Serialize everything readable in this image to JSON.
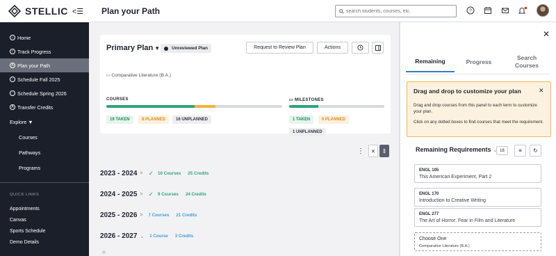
{
  "app": {
    "logo_text": "STELLIC",
    "collapse_label": "<☰",
    "page_title": "Plan your Path"
  },
  "search": {
    "placeholder": "search students, courses, etc."
  },
  "header_icons": [
    "help-icon",
    "calendar-icon",
    "mail-icon",
    "bell-icon"
  ],
  "sidebar": {
    "items": [
      {
        "label": "Home",
        "icon": "home-icon"
      },
      {
        "label": "Track Progress",
        "icon": "check-circle-icon"
      },
      {
        "label": "Plan your Path",
        "icon": "path-icon",
        "active": true
      },
      {
        "label": "Schedule Fall 2025",
        "icon": "schedule-icon"
      },
      {
        "label": "Schedule Spring 2026",
        "icon": "schedule-icon"
      },
      {
        "label": "Transfer Credits",
        "icon": "transfer-icon"
      }
    ],
    "explore_label": "Explore ▼",
    "explore_items": [
      "Courses",
      "Pathways",
      "Programs"
    ],
    "quick_links_title": "QUICK LINKS",
    "quick_links": [
      "Appointments",
      "Canvas",
      "Sports Schedule",
      "Demo Details"
    ]
  },
  "plan": {
    "name": "Primary Plan",
    "status": "Unreviewed Plan",
    "request_button": "Request to Review Plan",
    "actions_button": "Actions",
    "degree": "Comparative Literature (B.A.)",
    "courses": {
      "label": "COURSES",
      "taken_fraction": 0.5,
      "planned_fraction": 0.12,
      "chips": {
        "taken": "19 TAKEN",
        "planned": "8 PLANNED",
        "unplanned": "16 UNPLANNED"
      }
    },
    "milestones": {
      "label": "MILESTONES",
      "taken_fraction": 0.31,
      "chips": {
        "taken": "1 TAKEN",
        "planned": "0 PLANNED",
        "unplanned": "1 UNPLANNED"
      }
    }
  },
  "years": [
    {
      "label": "2023 - 2024",
      "check": true,
      "courses": "10 Courses",
      "credits": "25 Credits",
      "color": "green",
      "chevron": ">"
    },
    {
      "label": "2024 - 2025",
      "check": true,
      "courses": "9 Courses",
      "credits": "24 Credits",
      "color": "green",
      "chevron": ">"
    },
    {
      "label": "2025 - 2026",
      "check": false,
      "courses": "7 Courses",
      "credits": "21 Credits",
      "color": "blue",
      "chevron": ">"
    },
    {
      "label": "2026 - 2027",
      "check": false,
      "courses": "1 Course",
      "credits": "3 Credits",
      "color": "blue",
      "chevron": "⌄"
    }
  ],
  "panel": {
    "tabs": [
      "Remaining",
      "Progress",
      "Search Courses"
    ],
    "tip": {
      "title": "Drag and drop to customize your plan",
      "text1": "Drag and drop courses from this panel to each term to customize your plan.",
      "text2": "Click on any dotted boxes to find courses that meet the requirement."
    },
    "remaining_title": "Remaining Requirements",
    "remaining_count": "16",
    "cards": [
      {
        "code": "ENGL 105",
        "name": "This American Experiment, Part 2",
        "dotted": false
      },
      {
        "code": "ENGL 170",
        "name": "Introduction to Creative Writing",
        "dotted": false
      },
      {
        "code": "ENGL 277",
        "name": "The Art of Horror: Fear in Film and Literature",
        "dotted": false
      },
      {
        "code": "Choose One",
        "name": "Comparative Literature (B.A.)",
        "dotted": true
      }
    ]
  }
}
